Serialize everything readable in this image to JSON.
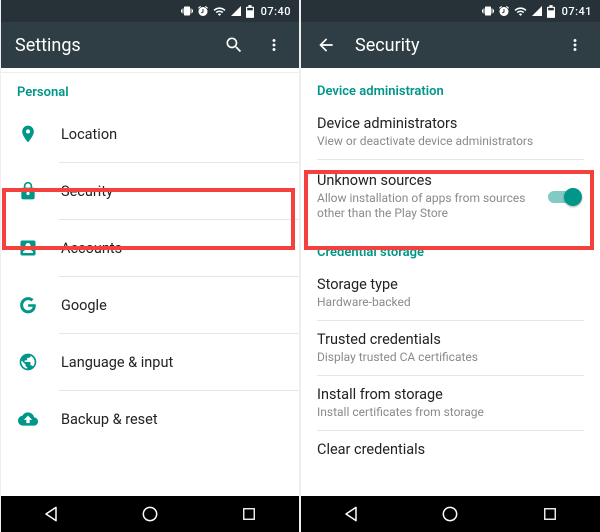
{
  "left": {
    "status_time": "07:40",
    "app_title": "Settings",
    "section_personal": "Personal",
    "rows": {
      "location": "Location",
      "security": "Security",
      "accounts": "Accounts",
      "google": "Google",
      "language": "Language & input",
      "backup": "Backup & reset"
    }
  },
  "right": {
    "status_time": "07:41",
    "app_title": "Security",
    "section_device_admin": "Device administration",
    "section_cred_storage": "Credential storage",
    "rows": {
      "device_admin_title": "Device administrators",
      "device_admin_sub": "View or deactivate device administrators",
      "unknown_title": "Unknown sources",
      "unknown_sub": "Allow installation of apps from sources other than the Play Store",
      "storage_type_title": "Storage type",
      "storage_type_sub": "Hardware-backed",
      "trusted_title": "Trusted credentials",
      "trusted_sub": "Display trusted CA certificates",
      "install_title": "Install from storage",
      "install_sub": "Install certificates from storage",
      "clear_title": "Clear credentials"
    }
  }
}
